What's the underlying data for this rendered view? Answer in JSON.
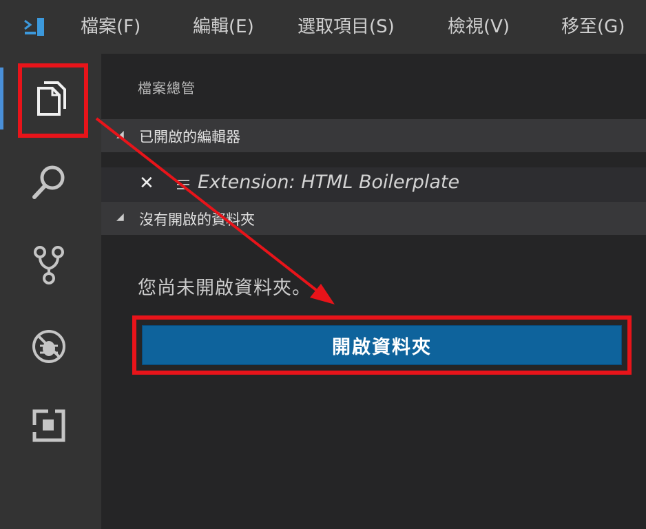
{
  "menubar": {
    "items": [
      "檔案(F)",
      "編輯(E)",
      "選取項目(S)",
      "檢視(V)",
      "移至(G)"
    ]
  },
  "activity_bar": {
    "icons": [
      "explorer-icon",
      "search-icon",
      "source-control-icon",
      "debug-icon",
      "extensions-icon"
    ],
    "accent": "#4a90d9"
  },
  "sidebar": {
    "title": "檔案總管",
    "open_editors": {
      "header": "已開啟的編輯器",
      "items": [
        {
          "name": "Extension: HTML Boilerplate"
        }
      ]
    },
    "no_folder": {
      "header": "沒有開啟的資料夾",
      "message": "您尚未開啟資料夾。",
      "button_label": "開啟資料夾"
    }
  },
  "annotation": {
    "highlight_color": "#e8141a"
  },
  "colors": {
    "button_bg": "#0e639c",
    "activity_bg": "#333333",
    "sidebar_bg": "#252526"
  }
}
